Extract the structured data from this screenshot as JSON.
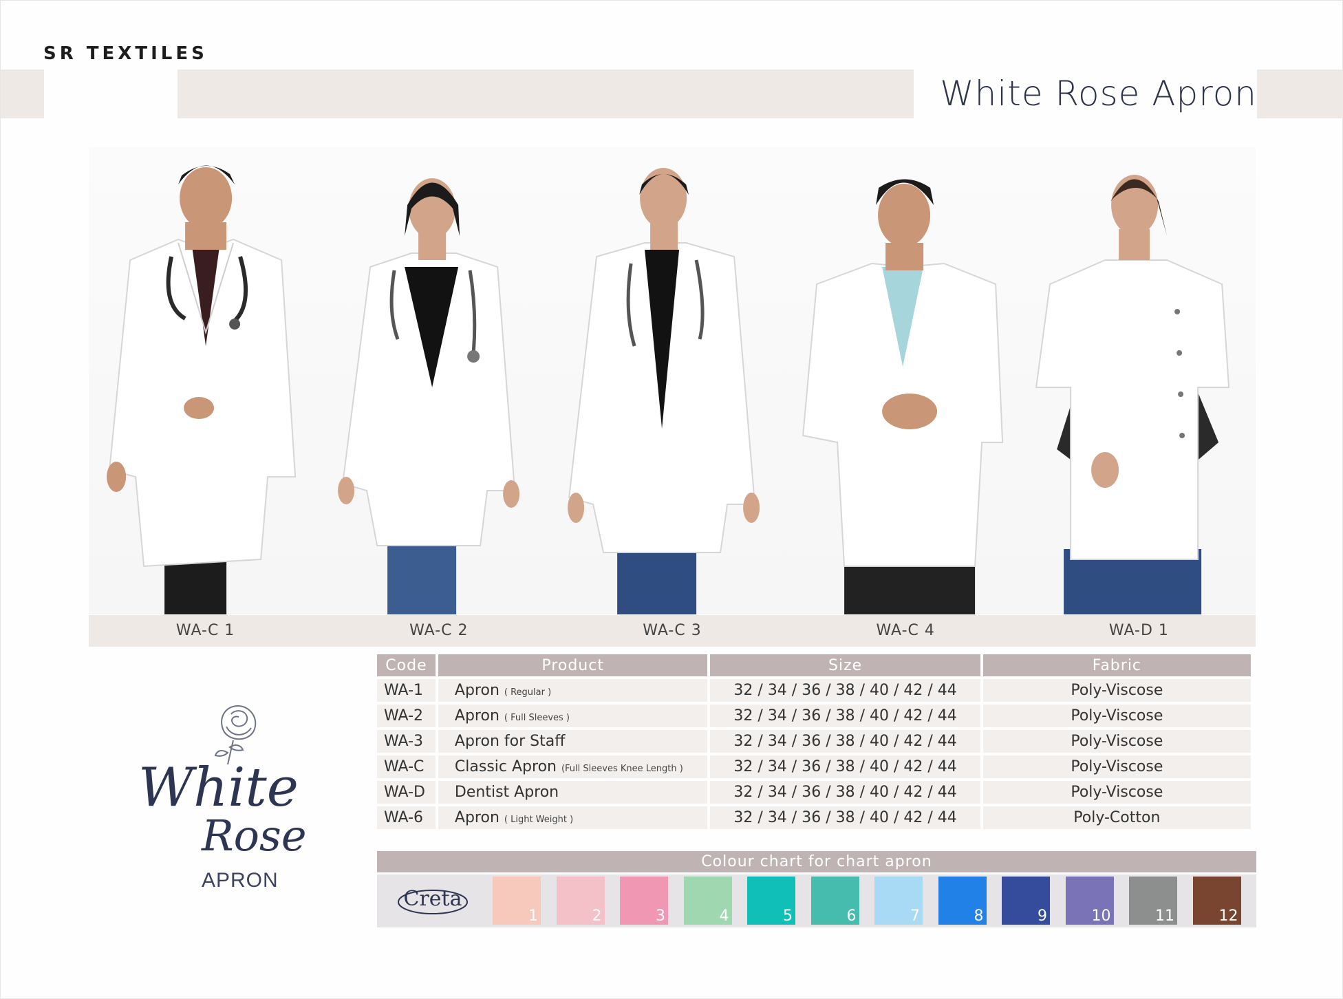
{
  "brand": "SR TEXTILES",
  "title": "White Rose Apron",
  "models": [
    {
      "code": "WA-C 1"
    },
    {
      "code": "WA-C 2"
    },
    {
      "code": "WA-C 3"
    },
    {
      "code": "WA-C 4"
    },
    {
      "code": "WA-D 1"
    }
  ],
  "logo": {
    "line1": "White",
    "line2": "Rose",
    "line3": "APRON"
  },
  "table": {
    "headers": {
      "code": "Code",
      "product": "Product",
      "size": "Size",
      "fabric": "Fabric"
    },
    "rows": [
      {
        "code": "WA-1",
        "product": "Apron",
        "note": "( Regular )",
        "size": "32 / 34 / 36 / 38 / 40 / 42 / 44",
        "fabric": "Poly-Viscose"
      },
      {
        "code": "WA-2",
        "product": "Apron",
        "note": "( Full Sleeves )",
        "size": "32 / 34 / 36 / 38 / 40 / 42 / 44",
        "fabric": "Poly-Viscose"
      },
      {
        "code": "WA-3",
        "product": "Apron for Staff",
        "note": "",
        "size": "32 / 34 / 36 / 38 / 40 / 42 / 44",
        "fabric": "Poly-Viscose"
      },
      {
        "code": "WA-C",
        "product": "Classic Apron",
        "note": "(Full Sleeves Knee Length )",
        "size": "32 / 34 / 36 / 38 / 40 / 42 / 44",
        "fabric": "Poly-Viscose"
      },
      {
        "code": "WA-D",
        "product": "Dentist Apron",
        "note": "",
        "size": "32 / 34 / 36 / 38 / 40 / 42 / 44",
        "fabric": "Poly-Viscose"
      },
      {
        "code": "WA-6",
        "product": "Apron",
        "note": "( Light Weight )",
        "size": "32 / 34 / 36 / 38 / 40 / 42 / 44",
        "fabric": "Poly-Cotton"
      }
    ]
  },
  "colour_chart": {
    "title": "Colour chart for chart apron",
    "fabric_brand": "Creta",
    "swatches": [
      {
        "num": "1",
        "color": "#f7c9bd"
      },
      {
        "num": "2",
        "color": "#f5c1c9"
      },
      {
        "num": "3",
        "color": "#f097b3"
      },
      {
        "num": "4",
        "color": "#9fd7b0"
      },
      {
        "num": "5",
        "color": "#0fbfb8"
      },
      {
        "num": "6",
        "color": "#45bcad"
      },
      {
        "num": "7",
        "color": "#a9daf5"
      },
      {
        "num": "8",
        "color": "#2181e6"
      },
      {
        "num": "9",
        "color": "#354b9c"
      },
      {
        "num": "10",
        "color": "#7b73b8"
      },
      {
        "num": "11",
        "color": "#8d8e8e"
      },
      {
        "num": "12",
        "color": "#7a4530"
      }
    ]
  },
  "colors": {
    "band": "#efe9e6",
    "header": "#bfb4b3",
    "title": "#2f3548",
    "coat": "#ffffff"
  }
}
